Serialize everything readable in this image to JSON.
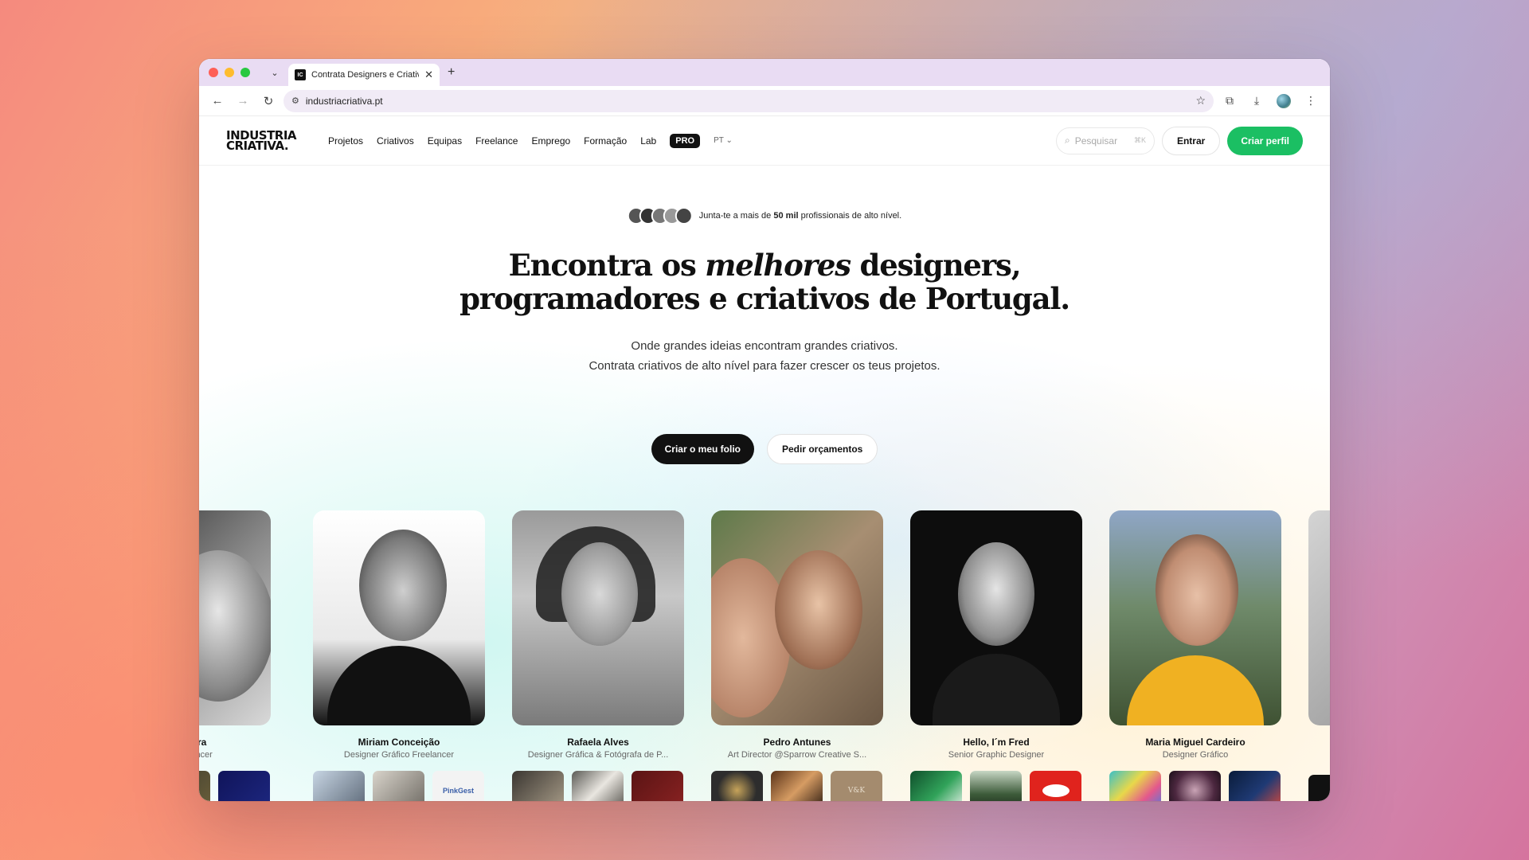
{
  "browser": {
    "tab_title": "Contrata Designers e Criativos",
    "tab_favicon": "IC",
    "url": "industriacriativa.pt",
    "icons": [
      "back-icon",
      "forward-icon",
      "reload-icon",
      "site-settings-icon",
      "bookmark-star-icon",
      "extensions-icon",
      "download-icon",
      "profile-icon",
      "kebab-menu-icon"
    ]
  },
  "nav": {
    "logo_line1": "INDUSTRIA",
    "logo_line2": "CRIATIVA.",
    "links": [
      "Projetos",
      "Criativos",
      "Equipas",
      "Freelance",
      "Emprego",
      "Formação",
      "Lab"
    ],
    "pro": "PRO",
    "lang": "PT",
    "search_placeholder": "Pesquisar",
    "search_shortcut": "⌘K",
    "login": "Entrar",
    "signup": "Criar perfil",
    "accent_color": "#1bbf63"
  },
  "hero": {
    "join_prefix": "Junta-te a mais de ",
    "join_bold": "50 mil",
    "join_suffix": " profissionais de alto nível.",
    "headline_1a": "Encontra os ",
    "headline_1em": "melhores",
    "headline_1b": " designers,",
    "headline_2": "programadores e criativos de Portugal.",
    "sub_1": "Onde grandes ideias encontram grandes criativos.",
    "sub_2": "Contrata criativos de alto nível para fazer crescer os teus projetos.",
    "cta_primary": "Criar o meu folio",
    "cta_secondary": "Pedir orçamentos"
  },
  "creatives": [
    {
      "name": "o Oliveira",
      "role": "ico Freelancer"
    },
    {
      "name": "Miriam Conceição",
      "role": "Designer Gráfico Freelancer"
    },
    {
      "name": "Rafaela Alves",
      "role": "Designer Gráfica & Fotógrafa de P..."
    },
    {
      "name": "Pedro Antunes",
      "role": "Art Director @Sparrow Creative S..."
    },
    {
      "name": "Hello, I´m Fred",
      "role": "Senior Graphic Designer"
    },
    {
      "name": "Maria Miguel Cardeiro",
      "role": "Designer Gráfico"
    }
  ],
  "thumb_texts": {
    "pinkgest": "PinkGest",
    "vok": "V&K"
  }
}
